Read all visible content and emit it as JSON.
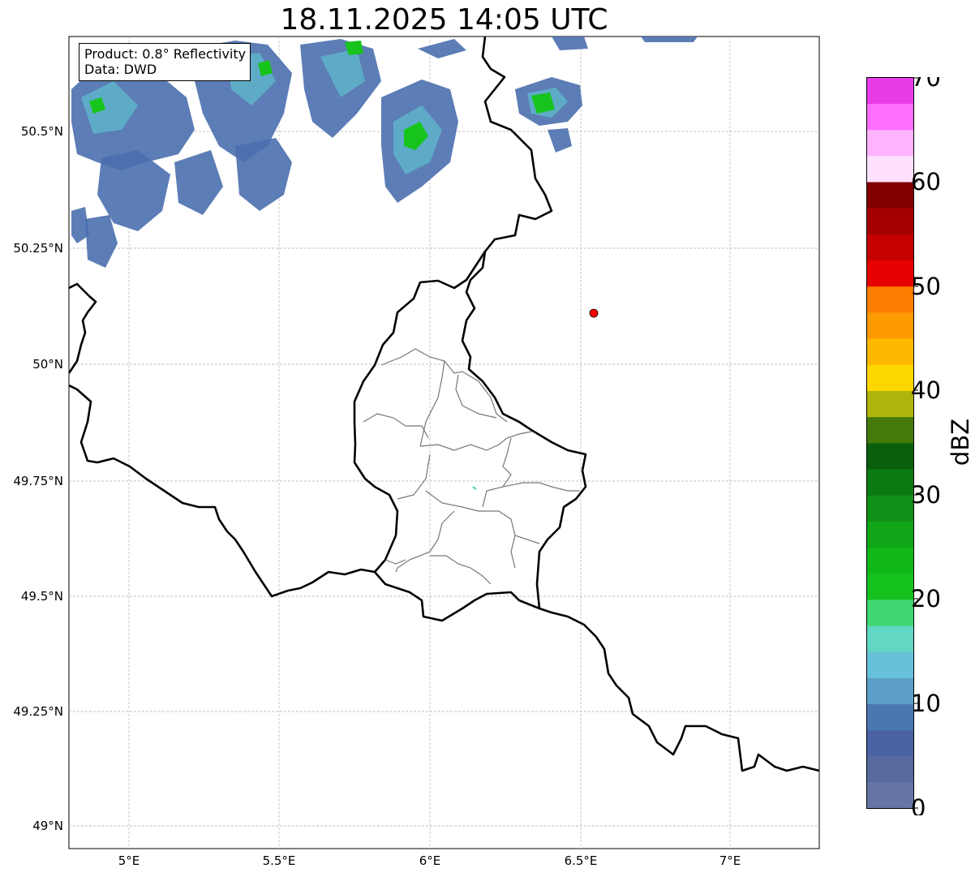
{
  "title": "18.11.2025 14:05 UTC",
  "info": {
    "product": "Product: 0.8° Reflectivity",
    "data": "Data: DWD"
  },
  "axes": {
    "lat_ticks": [
      "50.5°N",
      "50.25°N",
      "50°N",
      "49.75°N",
      "49.5°N",
      "49.25°N",
      "49°N"
    ],
    "lon_ticks": [
      "5°E",
      "5.5°E",
      "6°E",
      "6.5°E",
      "7°E"
    ]
  },
  "marker": {
    "lon": 6.55,
    "lat": 50.11,
    "color": "#ff0000"
  },
  "colorbar": {
    "label": "dBZ",
    "ticks": [
      "0",
      "10",
      "20",
      "30",
      "40",
      "50",
      "60",
      "70"
    ],
    "colors": [
      "#6475a6",
      "#5869a0",
      "#4a62a3",
      "#4a77b0",
      "#5b9ec8",
      "#66c2da",
      "#62d7c3",
      "#3fd772",
      "#15c11c",
      "#12b81a",
      "#10a617",
      "#0f8f16",
      "#0c7a12",
      "#0a5f0d",
      "#457a0b",
      "#afb30a",
      "#ffd700",
      "#ffb800",
      "#ff9a00",
      "#ff7d00",
      "#e60000",
      "#c40000",
      "#a50000",
      "#800000",
      "#ffe1ff",
      "#ffb3ff",
      "#ff6eff",
      "#e93ce9"
    ]
  }
}
